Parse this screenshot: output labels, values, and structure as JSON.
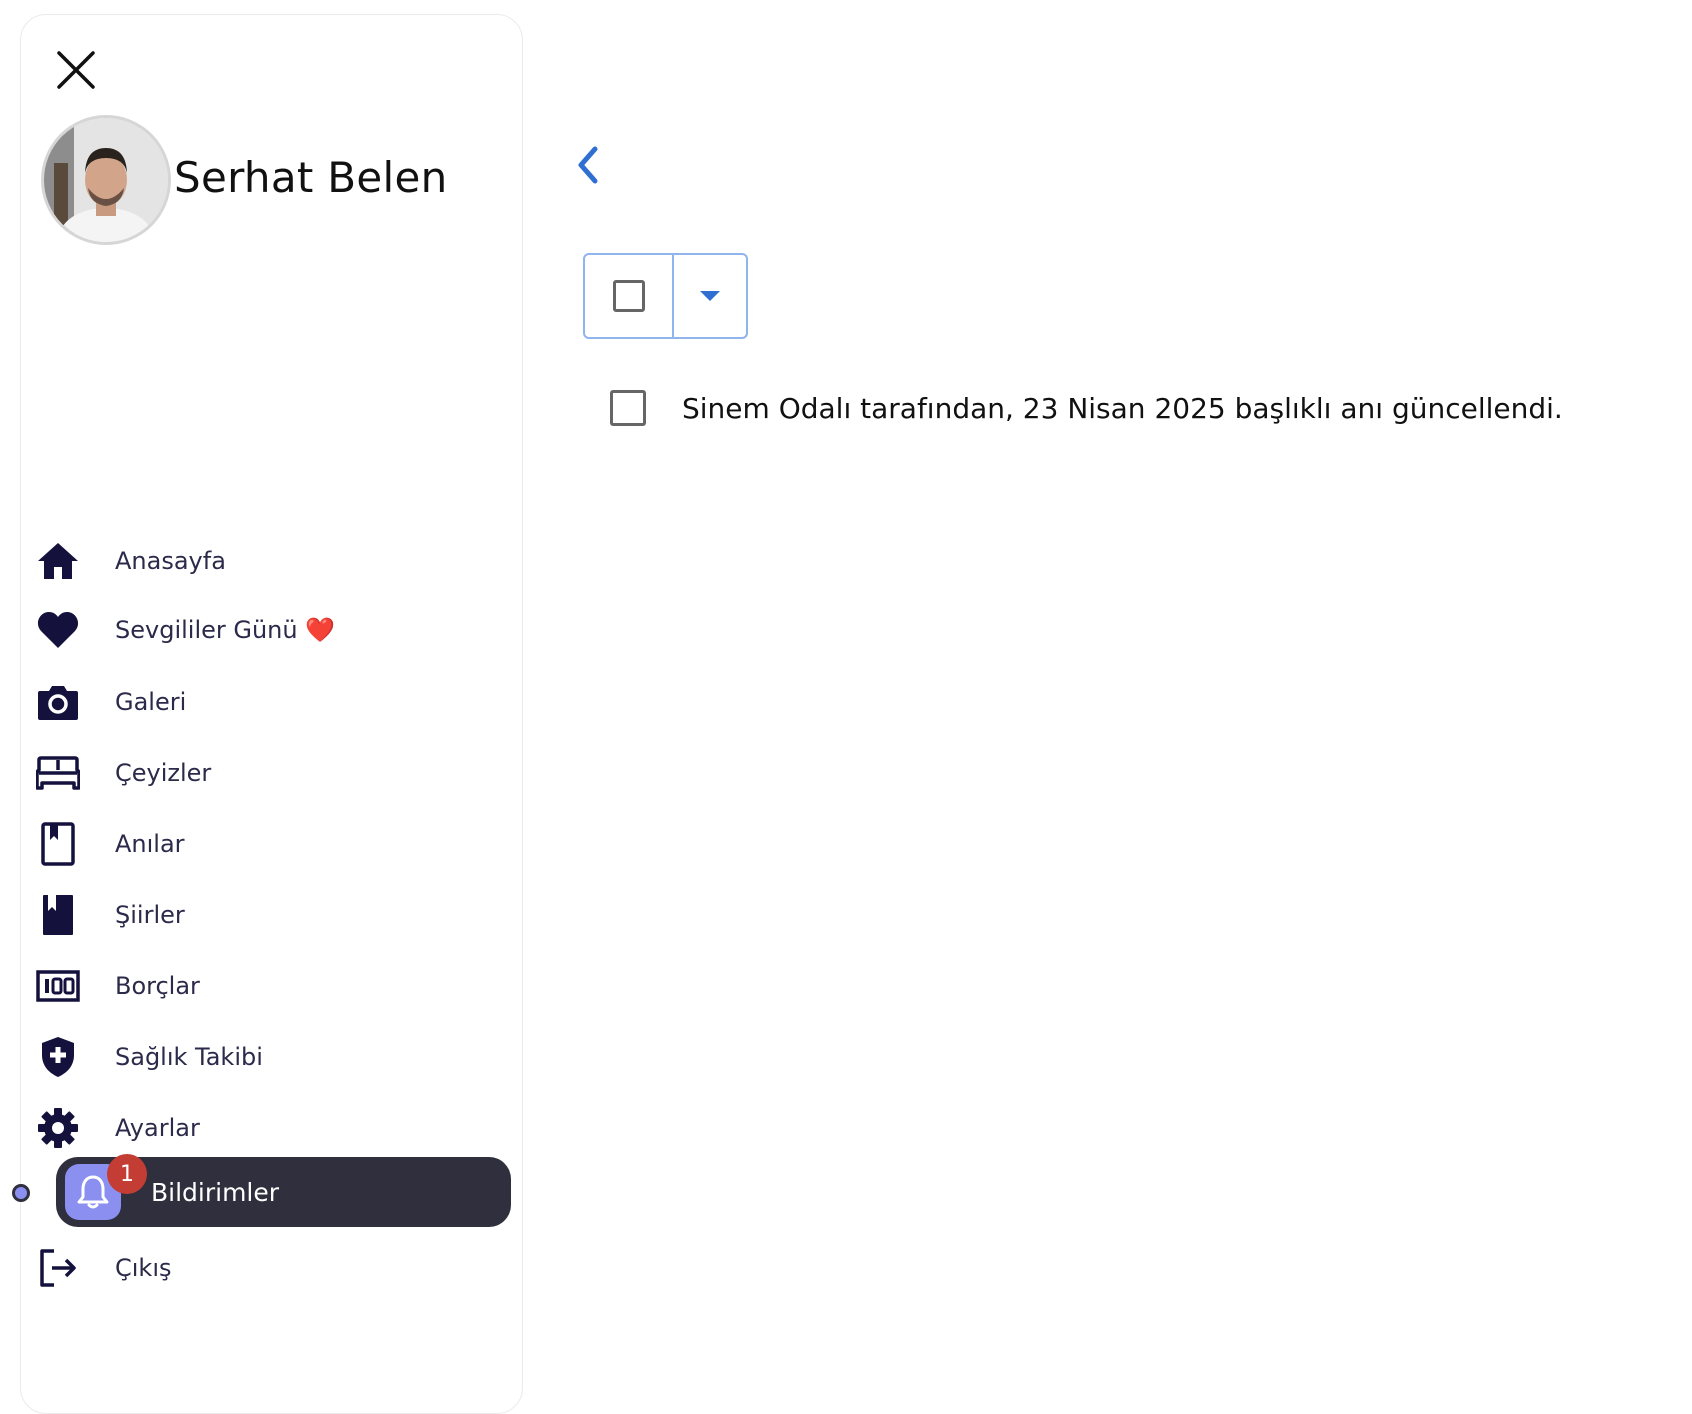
{
  "user": {
    "name": "Serhat Belen"
  },
  "sidebar": {
    "items": [
      {
        "label": "Anasayfa",
        "icon": "home-icon"
      },
      {
        "label": "Sevgililer Günü ❤️",
        "icon": "heart-icon"
      },
      {
        "label": "Galeri",
        "icon": "camera-icon"
      },
      {
        "label": "Çeyizler",
        "icon": "bed-icon"
      },
      {
        "label": "Anılar",
        "icon": "book-outline-icon"
      },
      {
        "label": "Şiirler",
        "icon": "book-filled-icon"
      },
      {
        "label": "Borçlar",
        "icon": "money-icon"
      },
      {
        "label": "Sağlık Takibi",
        "icon": "health-shield-icon"
      },
      {
        "label": "Ayarlar",
        "icon": "gear-icon"
      },
      {
        "label": "Bildirimler",
        "icon": "bell-icon",
        "badge": "1",
        "active": true
      },
      {
        "label": "Çıkış",
        "icon": "logout-icon"
      }
    ]
  },
  "notifications": {
    "items": [
      {
        "text": "Sinem Odalı tarafından, 23 Nisan 2025 başlıklı anı güncellendi."
      }
    ]
  },
  "colors": {
    "nav_icon": "#14123d",
    "active_bg": "#2f2f3d",
    "active_icon_bg": "#8a8ff0",
    "badge": "#c33d35",
    "accent_blue": "#2f6fd1"
  }
}
